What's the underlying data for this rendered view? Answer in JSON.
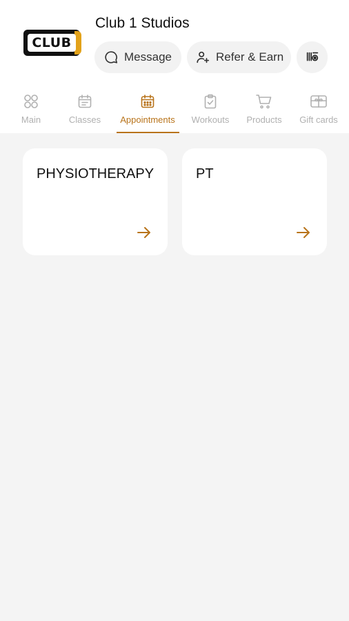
{
  "header": {
    "studio_name": "Club 1 Studios",
    "logo_text": "CLUB",
    "actions": {
      "message_label": "Message",
      "refer_label": "Refer & Earn",
      "more_icon": "loyalty-card-icon"
    }
  },
  "tabs": [
    {
      "label": "Main",
      "icon": "grid-icon",
      "active": false
    },
    {
      "label": "Classes",
      "icon": "calendar-list-icon",
      "active": false
    },
    {
      "label": "Appointments",
      "icon": "calendar-dots-icon",
      "active": true
    },
    {
      "label": "Workouts",
      "icon": "clipboard-check-icon",
      "active": false
    },
    {
      "label": "Products",
      "icon": "cart-icon",
      "active": false
    },
    {
      "label": "Gift cards",
      "icon": "gift-card-icon",
      "active": false
    }
  ],
  "appointments": [
    {
      "title": "PHYSIOTHERAPY",
      "icon": "arrow-right-icon"
    },
    {
      "title": "PT",
      "icon": "arrow-right-icon"
    }
  ],
  "colors": {
    "accent": "#b8731a",
    "background": "#f4f4f4",
    "card": "#ffffff",
    "inactive": "#b0b0b0",
    "logo_gold": "#e3a21a"
  }
}
